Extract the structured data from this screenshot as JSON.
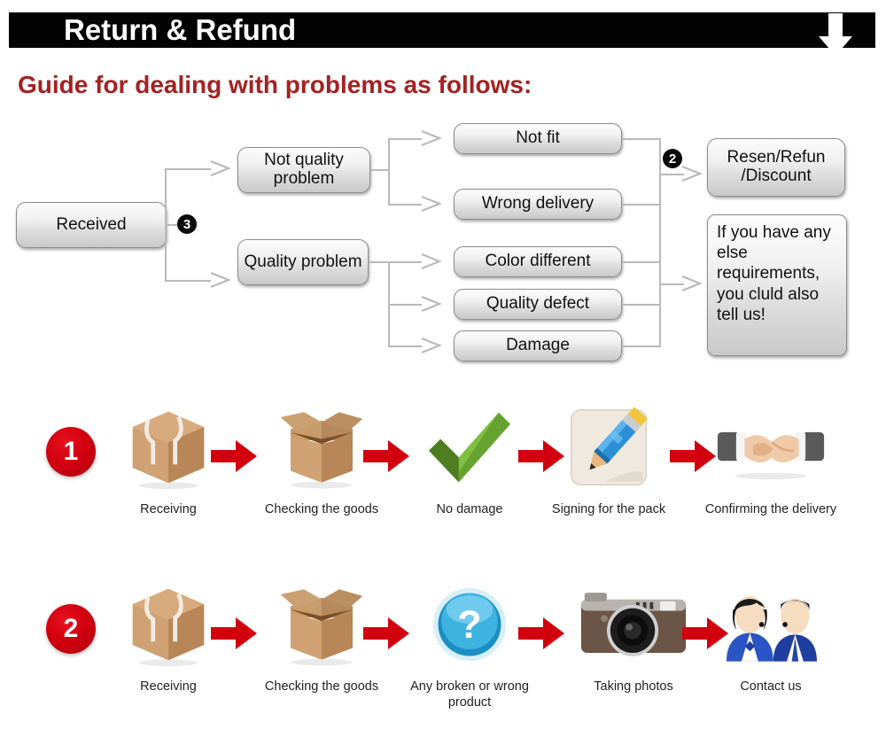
{
  "header": {
    "title": "Return & Refund",
    "arrow_icon": "down-arrow-icon"
  },
  "guide": {
    "heading": "Guide for dealing with problems as follows:"
  },
  "flowchart": {
    "start": {
      "label": "Received"
    },
    "badge_3": "3",
    "badge_2": "2",
    "branches": [
      {
        "label": "Not quality problem"
      },
      {
        "label": "Quality problem"
      }
    ],
    "issues": [
      {
        "label": "Not fit"
      },
      {
        "label": "Wrong delivery"
      },
      {
        "label": "Color different"
      },
      {
        "label": "Quality defect"
      },
      {
        "label": "Damage"
      }
    ],
    "outcomes": [
      {
        "label": "Resen/Refun /Discount"
      },
      {
        "label": "If you have any else requirements, you cluld also tell us!"
      }
    ]
  },
  "steps": {
    "row1": {
      "number": "1",
      "items": [
        {
          "icon": "closed-parcel-icon",
          "caption": "Receiving"
        },
        {
          "icon": "open-box-icon",
          "caption": "Checking the goods"
        },
        {
          "icon": "green-check-icon",
          "caption": "No damage"
        },
        {
          "icon": "pencil-signing-icon",
          "caption": "Signing for the pack"
        },
        {
          "icon": "handshake-icon",
          "caption": "Confirming the delivery"
        }
      ]
    },
    "row2": {
      "number": "2",
      "items": [
        {
          "icon": "closed-parcel-icon",
          "caption": "Receiving"
        },
        {
          "icon": "open-box-icon",
          "caption": "Checking the goods"
        },
        {
          "icon": "question-mark-icon",
          "caption": "Any broken or wrong product"
        },
        {
          "icon": "camera-icon",
          "caption": "Taking photos"
        },
        {
          "icon": "customer-service-people-icon",
          "caption": "Contact us"
        }
      ]
    },
    "arrow_icon": "red-right-arrow-icon"
  },
  "colors": {
    "header_bg": "#030303",
    "header_text": "#ffffff",
    "heading_red": "#A32222",
    "arrow_red": "#D2000F",
    "node_border": "#8c8c8c",
    "connector_gray": "#b9b9b9"
  }
}
